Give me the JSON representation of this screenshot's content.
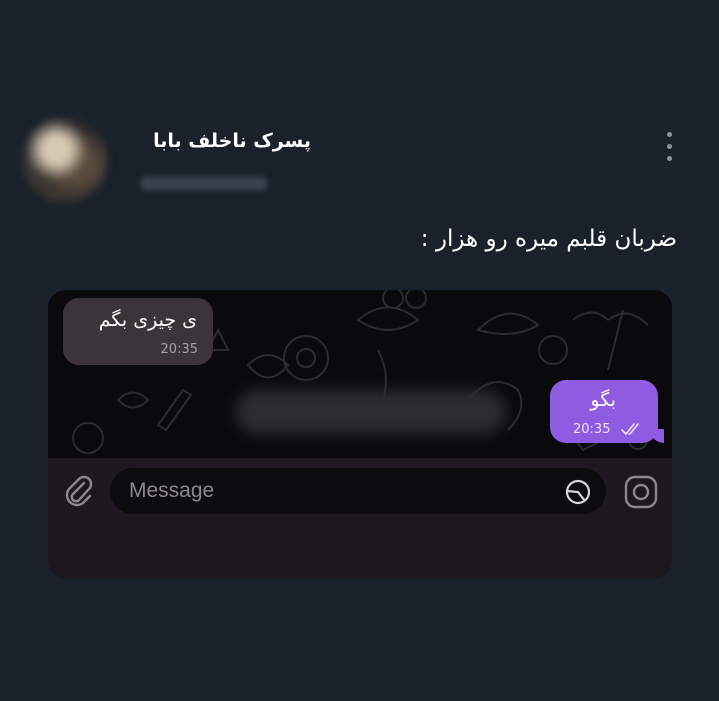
{
  "post": {
    "author_name": "پسرک ناخلف بابا",
    "text": "ضربان قلبم میره رو هزار :"
  },
  "chat": {
    "incoming": {
      "text": "ی چیزی بگم",
      "time": "20:35"
    },
    "outgoing": {
      "text": "بگو",
      "time": "20:35",
      "status": "read"
    }
  },
  "composer": {
    "placeholder": "Message"
  },
  "colors": {
    "background": "#1a212b",
    "outgoing_bubble": "#8f5be0",
    "incoming_bubble": "#3b3438"
  },
  "icons": [
    "more-vertical-icon",
    "paperclip-icon",
    "sticker-icon",
    "camera-icon",
    "double-check-icon"
  ]
}
